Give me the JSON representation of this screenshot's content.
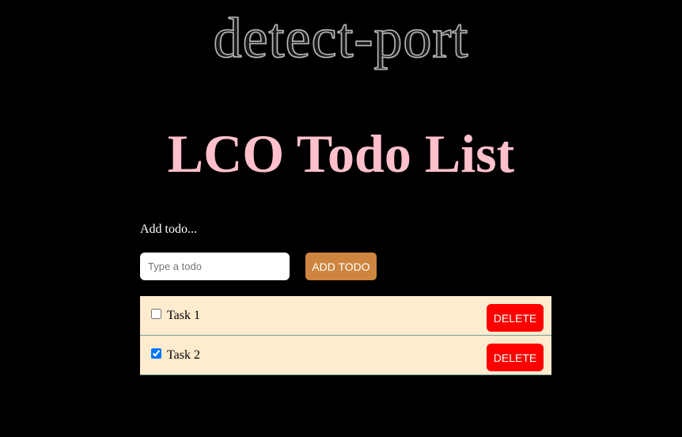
{
  "logo": {
    "text": "detect-port"
  },
  "page": {
    "title": "LCO Todo List"
  },
  "form": {
    "label": "Add todo...",
    "input_value": "",
    "input_placeholder": "Type a todo",
    "add_button_label": "ADD TODO"
  },
  "todos": [
    {
      "text": "Task 1",
      "completed": false,
      "delete_label": "DELETE"
    },
    {
      "text": "Task 2",
      "completed": true,
      "delete_label": "DELETE"
    }
  ],
  "colors": {
    "background": "#000000",
    "title": "#ffc0cb",
    "add_button": "#cd853f",
    "delete_button": "#ff0000",
    "list_item_background": "#ffebcd"
  }
}
